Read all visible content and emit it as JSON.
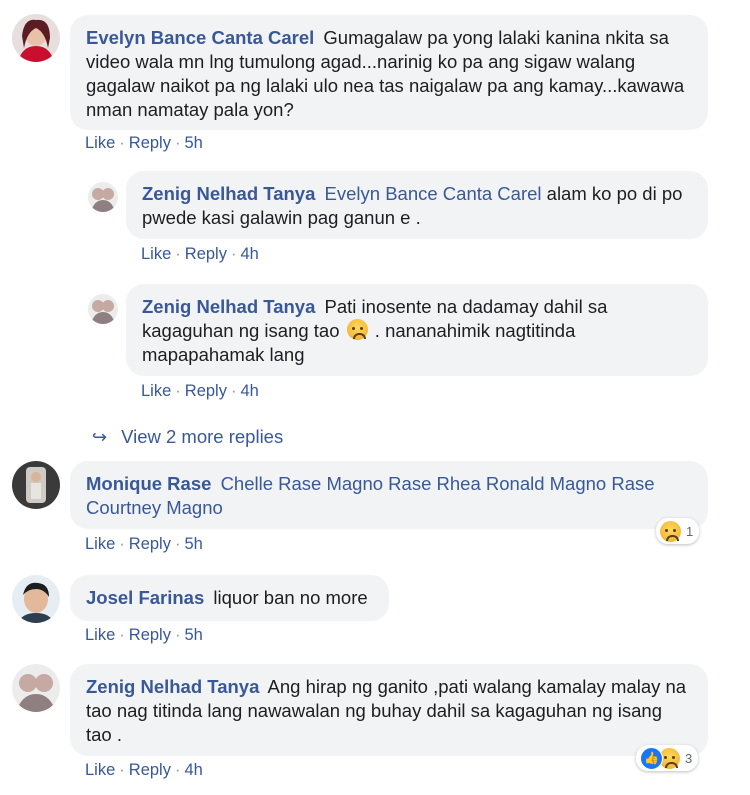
{
  "comments": [
    {
      "author": "Evelyn Bance Canta Carel",
      "text": "Gumagalaw pa yong lalaki kanina nkita sa video wala mn lng tumulong agad...narinig ko pa ang sigaw walang gagalaw naikot pa ng lalaki ulo nea tas naigalaw pa ang kamay...kawawa nman namatay pala yon?",
      "like": "Like",
      "reply": "Reply",
      "time": "5h"
    },
    {
      "author": "Zenig Nelhad Tanya",
      "mention": "Evelyn Bance Canta Carel",
      "text": "alam ko po di po pwede kasi galawin pag ganun e .",
      "like": "Like",
      "reply": "Reply",
      "time": "4h"
    },
    {
      "author": "Zenig Nelhad Tanya",
      "text_before": "Pati inosente na dadamay dahil sa kagaguhan ng isang tao",
      "text_after": ". nananahimik nagtitinda mapapahamak lang",
      "emoji": "sad-face-icon",
      "like": "Like",
      "reply": "Reply",
      "time": "4h"
    },
    {
      "author": "Monique Rase",
      "mention": "Chelle Rase Magno Rase Rhea Ronald Magno Rase Courtney Magno",
      "like": "Like",
      "reply": "Reply",
      "time": "5h",
      "reaction_count": "1"
    },
    {
      "author": "Josel Farinas",
      "text": "liquor ban no more",
      "like": "Like",
      "reply": "Reply",
      "time": "5h"
    },
    {
      "author": "Zenig Nelhad Tanya",
      "text": "Ang hirap ng ganito ,pati walang kamalay malay na tao nag titinda lang nawawalan ng buhay dahil sa kagaguhan ng isang tao .",
      "like": "Like",
      "reply": "Reply",
      "time": "4h",
      "reaction_count": "3"
    }
  ],
  "view_more": "View 2 more replies",
  "sep": "·",
  "colors": {
    "link": "#385898",
    "bubble": "#f2f3f5",
    "text": "#1c1e21"
  }
}
